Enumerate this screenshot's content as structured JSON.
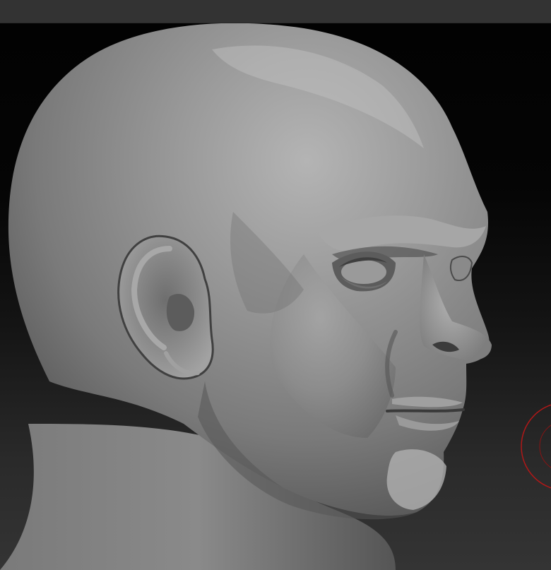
{
  "scene": {
    "object": "sculpted-head-model",
    "view": "three-quarter-right",
    "material_color": "#8c8c8c",
    "background_top": "#020202",
    "background_bottom": "#343434",
    "brush_cursor_color": "#b01818",
    "toolbar_color": "#333333"
  }
}
